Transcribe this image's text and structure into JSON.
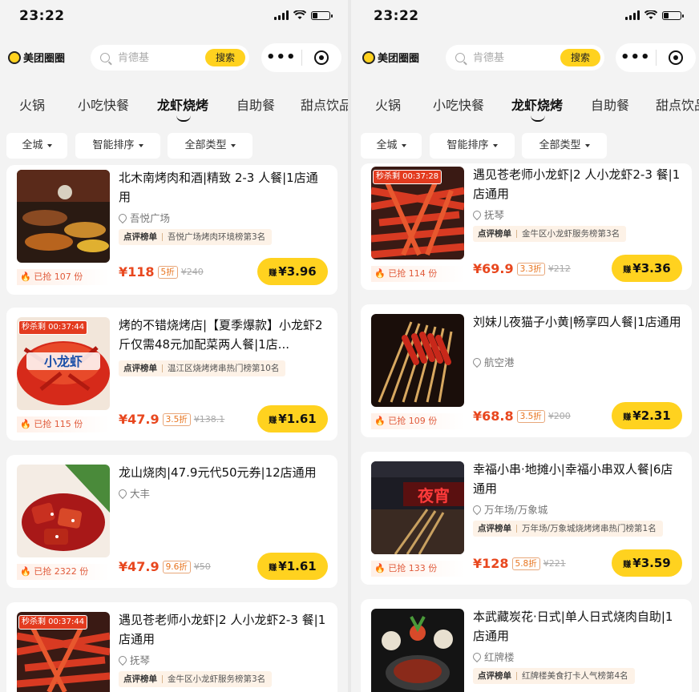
{
  "status_time": "23:22",
  "app_name": "美团圈圈",
  "search": {
    "placeholder": "肯德基",
    "button": "搜索"
  },
  "capsule": {
    "more": "•••"
  },
  "tabs": [
    "火锅",
    "小吃快餐",
    "龙虾烧烤",
    "自助餐",
    "甜点饮品"
  ],
  "active_tab": "龙虾烧烤",
  "filters": [
    "全城",
    "智能排序",
    "全部类型"
  ],
  "left_cards": [
    {
      "title": "北木南烤肉和酒|精致 2-3 人餐|1店通用",
      "location": "吾悦广场",
      "rank_tag": "点评榜单",
      "rank_text": "吾悦广场烤肉环境榜第3名",
      "sold": "已抢 107 份",
      "price": "¥118",
      "discount": "5折",
      "original": "¥240",
      "earn": "¥3.96"
    },
    {
      "flash": "秒杀剩 00:37:44",
      "title": "烤的不错烧烤店|【夏季爆款】小龙虾2斤仅需48元加配菜两人餐|1店...",
      "rank_tag": "点评榜单",
      "rank_text": "温江区烧烤烤串热门榜第10名",
      "sold": "已抢 115 份",
      "price": "¥47.9",
      "discount": "3.5折",
      "original": "¥138.1",
      "earn": "¥1.61"
    },
    {
      "title": "龙山烧肉|47.9元代50元券|12店通用",
      "location": "大丰",
      "sold": "已抢 2322 份",
      "price": "¥47.9",
      "discount": "9.6折",
      "original": "¥50",
      "earn": "¥1.61"
    },
    {
      "flash": "秒杀剩 00:37:44",
      "title": "遇见苍老师小龙虾|2 人小龙虾2-3 餐|1店通用",
      "location": "抚琴",
      "rank_tag": "点评榜单",
      "rank_text": "金牛区小龙虾服务榜第3名"
    }
  ],
  "right_cards": [
    {
      "flash": "秒杀剩 00:37:28",
      "title": "遇见苍老师小龙虾|2 人小龙虾2-3 餐|1店通用",
      "location": "抚琴",
      "rank_tag": "点评榜单",
      "rank_text": "金牛区小龙虾服务榜第3名",
      "sold": "已抢 114 份",
      "price": "¥69.9",
      "discount": "3.3折",
      "original": "¥212",
      "earn": "¥3.36"
    },
    {
      "title": "刘妹儿夜猫子小黄|畅享四人餐|1店通用",
      "location": "航空港",
      "sold": "已抢 109 份",
      "price": "¥68.8",
      "discount": "3.5折",
      "original": "¥200",
      "earn": "¥2.31"
    },
    {
      "title": "幸福小串·地摊小|幸福小串双人餐|6店通用",
      "location": "万年场/万象城",
      "rank_tag": "点评榜单",
      "rank_text": "万年场/万象城烧烤烤串热门榜第1名",
      "sold": "已抢 133 份",
      "price": "¥128",
      "discount": "5.8折",
      "original": "¥221",
      "earn": "¥3.59",
      "thumb_text": "夜宵"
    },
    {
      "title": "本武藏炭花·日式|单人日式烧肉自助|1店通用",
      "location": "红牌楼",
      "rank_tag": "点评榜单",
      "rank_text": "红牌楼美食打卡人气榜第4名"
    }
  ],
  "earn_prefix": "赚",
  "colors": {
    "accent": "#ffd21f",
    "price": "#e8471e",
    "flash": "#e33b1f"
  }
}
